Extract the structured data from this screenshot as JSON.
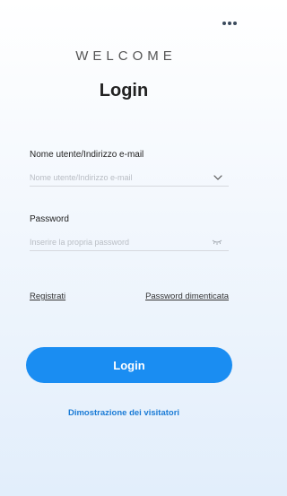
{
  "header": {
    "more_icon": "more-horizontal-icon",
    "welcome": "WELCOME",
    "title": "Login"
  },
  "form": {
    "username": {
      "label": "Nome utente/Indirizzo e-mail",
      "placeholder": "Nome utente/Indirizzo e-mail",
      "value": "",
      "icon": "chevron-down-icon"
    },
    "password": {
      "label": "Password",
      "placeholder": "Inserire la propria password",
      "value": "",
      "icon": "eye-closed-icon"
    }
  },
  "links": {
    "register": "Registrati",
    "forgot_password": "Password dimenticata"
  },
  "actions": {
    "login_label": "Login",
    "demo_label": "Dimostrazione dei visitatori"
  },
  "colors": {
    "accent": "#1a8df2",
    "link_blue": "#1a7bd6"
  }
}
